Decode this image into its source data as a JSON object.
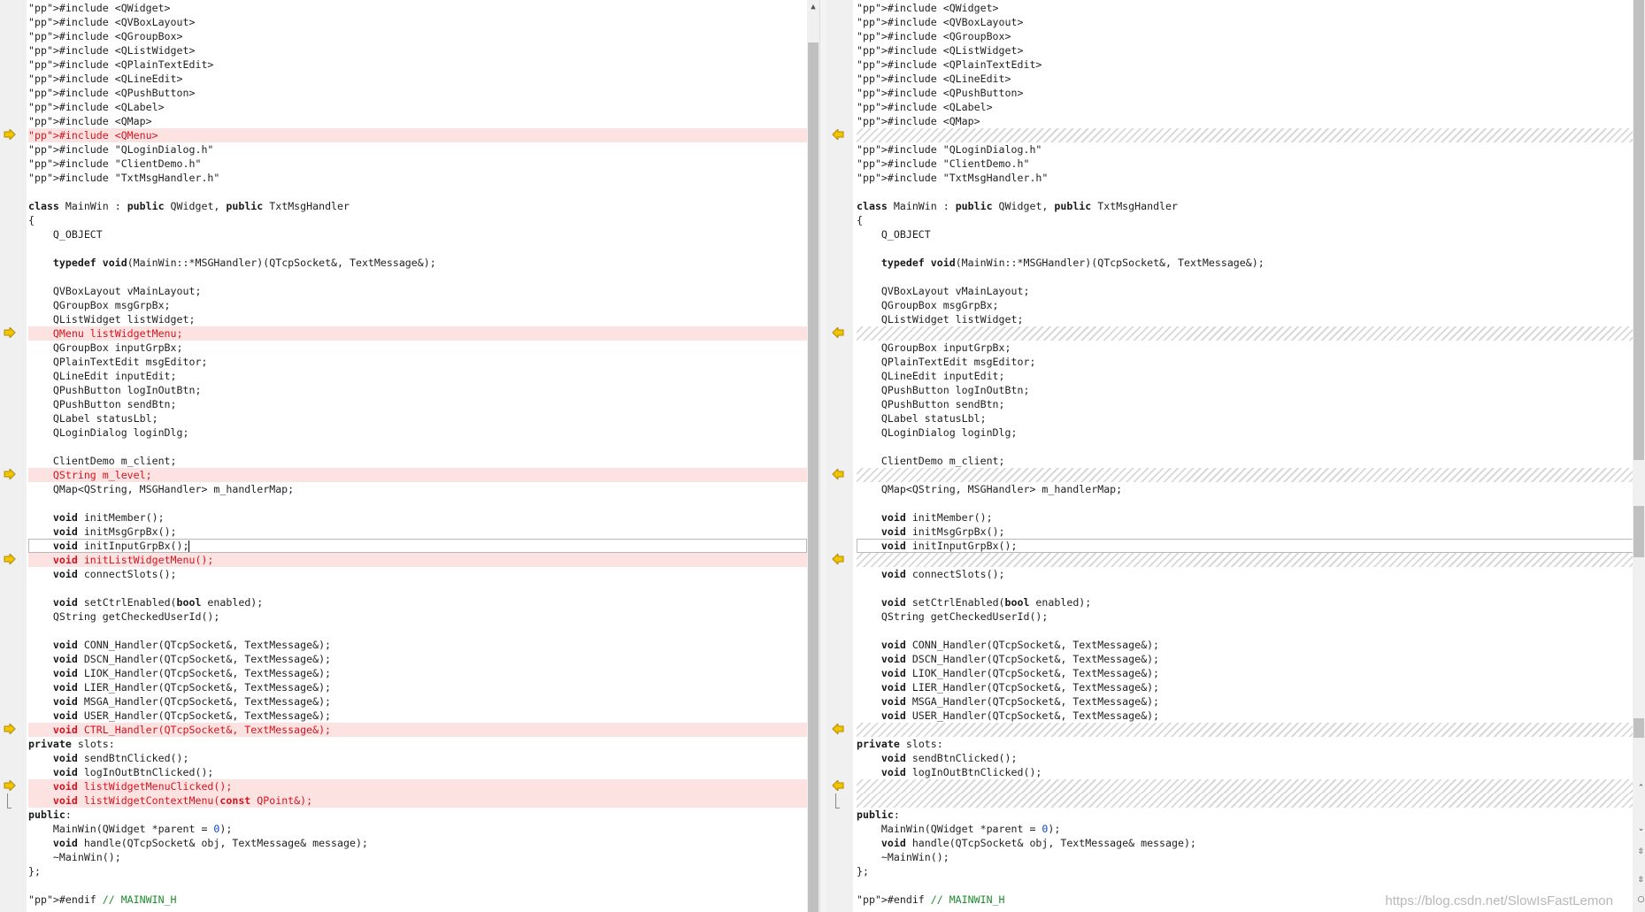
{
  "left_pane": {
    "lines": [
      {
        "text": "#include <QWidget>",
        "kind": "normal"
      },
      {
        "text": "#include <QVBoxLayout>",
        "kind": "normal"
      },
      {
        "text": "#include <QGroupBox>",
        "kind": "normal"
      },
      {
        "text": "#include <QListWidget>",
        "kind": "normal"
      },
      {
        "text": "#include <QPlainTextEdit>",
        "kind": "normal"
      },
      {
        "text": "#include <QLineEdit>",
        "kind": "normal"
      },
      {
        "text": "#include <QPushButton>",
        "kind": "normal"
      },
      {
        "text": "#include <QLabel>",
        "kind": "normal"
      },
      {
        "text": "#include <QMap>",
        "kind": "normal"
      },
      {
        "text": "#include <QMenu>",
        "kind": "diff"
      },
      {
        "text": "#include \"QLoginDialog.h\"",
        "kind": "normal"
      },
      {
        "text": "#include \"ClientDemo.h\"",
        "kind": "normal"
      },
      {
        "text": "#include \"TxtMsgHandler.h\"",
        "kind": "normal"
      },
      {
        "text": "",
        "kind": "normal"
      },
      {
        "text": "class MainWin : public QWidget, public TxtMsgHandler",
        "kind": "normal"
      },
      {
        "text": "{",
        "kind": "normal"
      },
      {
        "text": "    Q_OBJECT",
        "kind": "normal"
      },
      {
        "text": "",
        "kind": "normal"
      },
      {
        "text": "    typedef void(MainWin::*MSGHandler)(QTcpSocket&, TextMessage&);",
        "kind": "normal"
      },
      {
        "text": "",
        "kind": "normal"
      },
      {
        "text": "    QVBoxLayout vMainLayout;",
        "kind": "normal"
      },
      {
        "text": "    QGroupBox msgGrpBx;",
        "kind": "normal"
      },
      {
        "text": "    QListWidget listWidget;",
        "kind": "normal"
      },
      {
        "text": "    QMenu listWidgetMenu;",
        "kind": "diff"
      },
      {
        "text": "    QGroupBox inputGrpBx;",
        "kind": "normal"
      },
      {
        "text": "    QPlainTextEdit msgEditor;",
        "kind": "normal"
      },
      {
        "text": "    QLineEdit inputEdit;",
        "kind": "normal"
      },
      {
        "text": "    QPushButton logInOutBtn;",
        "kind": "normal"
      },
      {
        "text": "    QPushButton sendBtn;",
        "kind": "normal"
      },
      {
        "text": "    QLabel statusLbl;",
        "kind": "normal"
      },
      {
        "text": "    QLoginDialog loginDlg;",
        "kind": "normal"
      },
      {
        "text": "",
        "kind": "normal"
      },
      {
        "text": "    ClientDemo m_client;",
        "kind": "normal"
      },
      {
        "text": "    QString m_level;",
        "kind": "diff"
      },
      {
        "text": "    QMap<QString, MSGHandler> m_handlerMap;",
        "kind": "normal"
      },
      {
        "text": "",
        "kind": "normal"
      },
      {
        "text": "    void initMember();",
        "kind": "normal"
      },
      {
        "text": "    void initMsgGrpBx();",
        "kind": "normal"
      },
      {
        "text": "    void initInputGrpBx();",
        "kind": "current"
      },
      {
        "text": "    void initListWidgetMenu();",
        "kind": "diff"
      },
      {
        "text": "    void connectSlots();",
        "kind": "normal"
      },
      {
        "text": "",
        "kind": "normal"
      },
      {
        "text": "    void setCtrlEnabled(bool enabled);",
        "kind": "normal"
      },
      {
        "text": "    QString getCheckedUserId();",
        "kind": "normal"
      },
      {
        "text": "",
        "kind": "normal"
      },
      {
        "text": "    void CONN_Handler(QTcpSocket&, TextMessage&);",
        "kind": "normal"
      },
      {
        "text": "    void DSCN_Handler(QTcpSocket&, TextMessage&);",
        "kind": "normal"
      },
      {
        "text": "    void LIOK_Handler(QTcpSocket&, TextMessage&);",
        "kind": "normal"
      },
      {
        "text": "    void LIER_Handler(QTcpSocket&, TextMessage&);",
        "kind": "normal"
      },
      {
        "text": "    void MSGA_Handler(QTcpSocket&, TextMessage&);",
        "kind": "normal"
      },
      {
        "text": "    void USER_Handler(QTcpSocket&, TextMessage&);",
        "kind": "normal"
      },
      {
        "text": "    void CTRL_Handler(QTcpSocket&, TextMessage&);",
        "kind": "diff"
      },
      {
        "text": "private slots:",
        "kind": "normal"
      },
      {
        "text": "    void sendBtnClicked();",
        "kind": "normal"
      },
      {
        "text": "    void logInOutBtnClicked();",
        "kind": "normal"
      },
      {
        "text": "    void listWidgetMenuClicked();",
        "kind": "diff"
      },
      {
        "text": "    void listWidgetContextMenu(const QPoint&);",
        "kind": "diff2"
      },
      {
        "text": "public:",
        "kind": "normal"
      },
      {
        "text": "    MainWin(QWidget *parent = 0);",
        "kind": "normal"
      },
      {
        "text": "    void handle(QTcpSocket& obj, TextMessage& message);",
        "kind": "normal"
      },
      {
        "text": "    ~MainWin();",
        "kind": "normal"
      },
      {
        "text": "};",
        "kind": "normal"
      },
      {
        "text": "",
        "kind": "normal"
      },
      {
        "text": "#endif // MAINWIN_H",
        "kind": "normal"
      }
    ]
  },
  "right_pane": {
    "lines": [
      {
        "text": "#include <QWidget>",
        "kind": "normal"
      },
      {
        "text": "#include <QVBoxLayout>",
        "kind": "normal"
      },
      {
        "text": "#include <QGroupBox>",
        "kind": "normal"
      },
      {
        "text": "#include <QListWidget>",
        "kind": "normal"
      },
      {
        "text": "#include <QPlainTextEdit>",
        "kind": "normal"
      },
      {
        "text": "#include <QLineEdit>",
        "kind": "normal"
      },
      {
        "text": "#include <QPushButton>",
        "kind": "normal"
      },
      {
        "text": "#include <QLabel>",
        "kind": "normal"
      },
      {
        "text": "#include <QMap>",
        "kind": "normal"
      },
      {
        "text": "",
        "kind": "placeholder"
      },
      {
        "text": "#include \"QLoginDialog.h\"",
        "kind": "normal"
      },
      {
        "text": "#include \"ClientDemo.h\"",
        "kind": "normal"
      },
      {
        "text": "#include \"TxtMsgHandler.h\"",
        "kind": "normal"
      },
      {
        "text": "",
        "kind": "normal"
      },
      {
        "text": "class MainWin : public QWidget, public TxtMsgHandler",
        "kind": "normal"
      },
      {
        "text": "{",
        "kind": "normal"
      },
      {
        "text": "    Q_OBJECT",
        "kind": "normal"
      },
      {
        "text": "",
        "kind": "normal"
      },
      {
        "text": "    typedef void(MainWin::*MSGHandler)(QTcpSocket&, TextMessage&);",
        "kind": "normal"
      },
      {
        "text": "",
        "kind": "normal"
      },
      {
        "text": "    QVBoxLayout vMainLayout;",
        "kind": "normal"
      },
      {
        "text": "    QGroupBox msgGrpBx;",
        "kind": "normal"
      },
      {
        "text": "    QListWidget listWidget;",
        "kind": "normal"
      },
      {
        "text": "",
        "kind": "placeholder"
      },
      {
        "text": "    QGroupBox inputGrpBx;",
        "kind": "normal"
      },
      {
        "text": "    QPlainTextEdit msgEditor;",
        "kind": "normal"
      },
      {
        "text": "    QLineEdit inputEdit;",
        "kind": "normal"
      },
      {
        "text": "    QPushButton logInOutBtn;",
        "kind": "normal"
      },
      {
        "text": "    QPushButton sendBtn;",
        "kind": "normal"
      },
      {
        "text": "    QLabel statusLbl;",
        "kind": "normal"
      },
      {
        "text": "    QLoginDialog loginDlg;",
        "kind": "normal"
      },
      {
        "text": "",
        "kind": "normal"
      },
      {
        "text": "    ClientDemo m_client;",
        "kind": "normal"
      },
      {
        "text": "",
        "kind": "placeholder"
      },
      {
        "text": "    QMap<QString, MSGHandler> m_handlerMap;",
        "kind": "normal"
      },
      {
        "text": "",
        "kind": "normal"
      },
      {
        "text": "    void initMember();",
        "kind": "normal"
      },
      {
        "text": "    void initMsgGrpBx();",
        "kind": "normal"
      },
      {
        "text": "    void initInputGrpBx();",
        "kind": "current"
      },
      {
        "text": "",
        "kind": "placeholder"
      },
      {
        "text": "    void connectSlots();",
        "kind": "normal"
      },
      {
        "text": "",
        "kind": "normal"
      },
      {
        "text": "    void setCtrlEnabled(bool enabled);",
        "kind": "normal"
      },
      {
        "text": "    QString getCheckedUserId();",
        "kind": "normal"
      },
      {
        "text": "",
        "kind": "normal"
      },
      {
        "text": "    void CONN_Handler(QTcpSocket&, TextMessage&);",
        "kind": "normal"
      },
      {
        "text": "    void DSCN_Handler(QTcpSocket&, TextMessage&);",
        "kind": "normal"
      },
      {
        "text": "    void LIOK_Handler(QTcpSocket&, TextMessage&);",
        "kind": "normal"
      },
      {
        "text": "    void LIER_Handler(QTcpSocket&, TextMessage&);",
        "kind": "normal"
      },
      {
        "text": "    void MSGA_Handler(QTcpSocket&, TextMessage&);",
        "kind": "normal"
      },
      {
        "text": "    void USER_Handler(QTcpSocket&, TextMessage&);",
        "kind": "normal"
      },
      {
        "text": "",
        "kind": "placeholder"
      },
      {
        "text": "private slots:",
        "kind": "normal"
      },
      {
        "text": "    void sendBtnClicked();",
        "kind": "normal"
      },
      {
        "text": "    void logInOutBtnClicked();",
        "kind": "normal"
      },
      {
        "text": "",
        "kind": "placeholder"
      },
      {
        "text": "",
        "kind": "placeholder"
      },
      {
        "text": "public:",
        "kind": "normal"
      },
      {
        "text": "    MainWin(QWidget *parent = 0);",
        "kind": "normal"
      },
      {
        "text": "    void handle(QTcpSocket& obj, TextMessage& message);",
        "kind": "normal"
      },
      {
        "text": "    ~MainWin();",
        "kind": "normal"
      },
      {
        "text": "};",
        "kind": "normal"
      },
      {
        "text": "",
        "kind": "normal"
      },
      {
        "text": "#endif // MAINWIN_H",
        "kind": "normal"
      }
    ]
  },
  "icons": {
    "diff_marker": "arrow-right-icon",
    "scroll_up": "chevron-up-icon",
    "scroll_down": "chevron-down-icon"
  },
  "colors": {
    "diff_background": "#fde2e2",
    "diff_text": "#d4141e",
    "marker": "#e8b000",
    "string": "#1e8a2d",
    "preprocessor": "#8a2270",
    "number": "#0a46b8"
  },
  "watermark": "https://blog.csdn.net/SlowIsFastLemon"
}
